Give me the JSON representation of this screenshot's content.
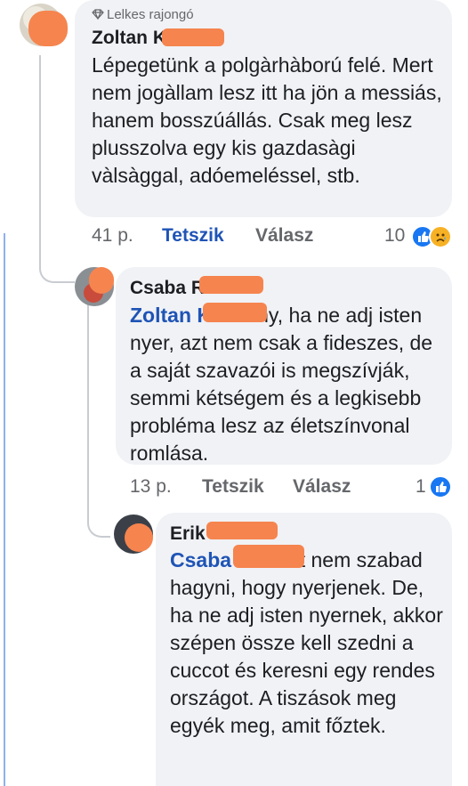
{
  "comments": [
    {
      "badge": "Lelkes rajongó",
      "author": "Zoltan K",
      "mention": "",
      "body": "Lépegetünk a polgàrhàború felé. Mert nem jogàllam lesz itt ha jön a messiás, hanem bosszúállás. Csak meg lesz plusszolva egy kis gazdasàgi vàlsàggal, adóemeléssel, stb.",
      "time": "41 p.",
      "like_label": "Tetszik",
      "reply_label": "Válasz",
      "reaction_count": "10",
      "reaction_icons": [
        "like-icon",
        "sad-icon"
      ]
    },
    {
      "author": "Csaba R",
      "mention": "Zoltan K",
      "body": "Bizony, ha ne adj isten nyer, azt nem csak a fideszes, de a saját szavazói is megszívják, semmi kétségem és a legkisebb probléma lesz az életszínvonal romlása.",
      "time": "13 p.",
      "like_label": "Tetszik",
      "reply_label": "Válasz",
      "reaction_count": "1",
      "reaction_icons": [
        "like-icon"
      ]
    },
    {
      "author": "Erik K",
      "mention": "Csaba R",
      "body": "Ezért nem szabad hagyni, hogy nyerjenek. De, ha ne adj isten nyernek, akkor szépen össze kell szedni a cuccot és keresni egy rendes országot. A tiszások meg egyék meg, amit főztek."
    }
  ],
  "colors": {
    "bubble": "#f0f2f5",
    "mention_blue": "#1f54b6",
    "meta_gray": "#65676b",
    "redaction_orange": "#f6844e"
  }
}
